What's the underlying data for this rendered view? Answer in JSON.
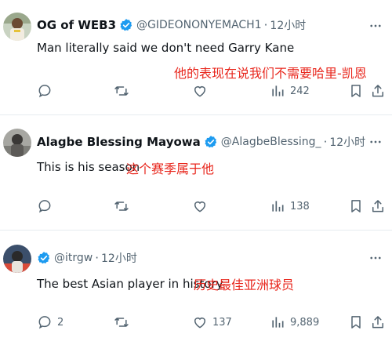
{
  "tweets": [
    {
      "name": "OG of WEB3",
      "handle": "@GIDEONONYEMACH1",
      "dot": "·",
      "time": "12小时",
      "text": "Man literally said we don't need Garry Kane",
      "translation": "他的表现在说我们不需要哈里-凯恩",
      "actions": {
        "reply": "",
        "retweet": "",
        "like": "",
        "views": "242"
      },
      "icons": [
        "avatar",
        "verified-badge-icon",
        "more-icon",
        "reply-icon",
        "retweet-icon",
        "like-icon",
        "views-icon",
        "bookmark-icon",
        "share-icon"
      ]
    },
    {
      "name": "Alagbe Blessing Mayowa",
      "handle": "@AlagbeBlessing_",
      "dot": "·",
      "time": "12小时",
      "text": "This is his season",
      "translation": "这个赛季属于他",
      "actions": {
        "reply": "",
        "retweet": "",
        "like": "",
        "views": "138"
      }
    },
    {
      "name": "",
      "handle": "@itrgw",
      "dot": "·",
      "time": "12小时",
      "text": "The best Asian player in history",
      "translation": "历史最佳亚洲球员",
      "actions": {
        "reply": "2",
        "retweet": "",
        "like": "137",
        "views": "9,889"
      }
    }
  ],
  "colors": {
    "verified": "#1d9bf0",
    "translation": "#e8261c",
    "secondary_text": "#536471"
  }
}
